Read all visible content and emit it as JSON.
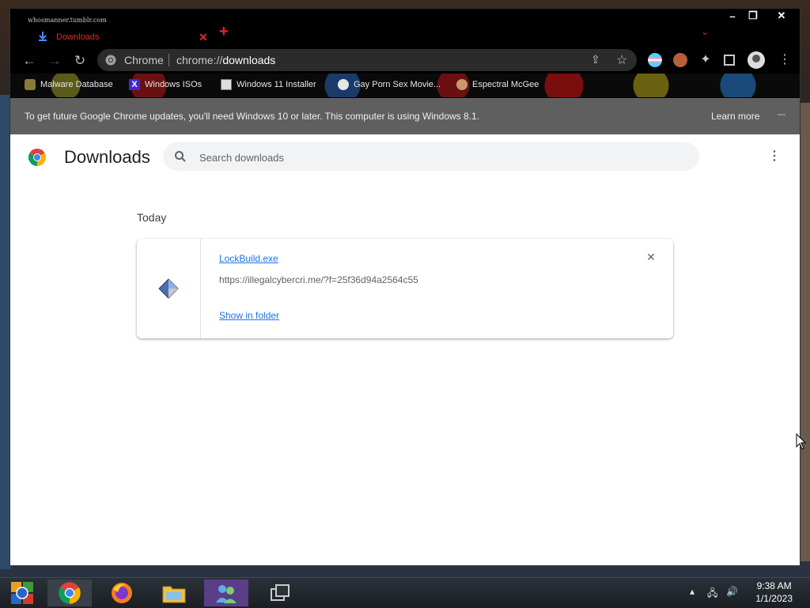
{
  "tab": {
    "site_text": "whosmanner.tumblr.com",
    "title": "Downloads"
  },
  "omnibox": {
    "origin": "Chrome",
    "url_scheme": "chrome://",
    "url_path": "downloads"
  },
  "bookmarks": [
    {
      "label": "Malware Database",
      "icon": "malware-db-icon"
    },
    {
      "label": "Windows ISOs",
      "icon": "x-icon"
    },
    {
      "label": "Windows 11 Installer",
      "icon": "installer-icon"
    },
    {
      "label": "Gay Porn Sex Movie...",
      "icon": "globe-icon"
    },
    {
      "label": "Espectral McGee",
      "icon": "avatar-icon"
    }
  ],
  "infobar": {
    "message": "To get future Google Chrome updates, you'll need Windows 10 or later. This computer is using Windows 8.1.",
    "learn_more": "Learn more"
  },
  "page": {
    "title": "Downloads",
    "search_placeholder": "Search downloads"
  },
  "downloads": {
    "date_group": "Today",
    "items": [
      {
        "filename": "LockBuild.exe",
        "url": "https://illegalcybercri.me/?f=25f36d94a2564c55",
        "action": "Show in folder"
      }
    ]
  },
  "taskbar": {
    "apps": [
      "start-icon",
      "chrome-icon",
      "firefox-icon",
      "file-explorer-icon",
      "messenger-icon",
      "task-view-icon"
    ],
    "time": "9:38 AM",
    "date": "1/1/2023"
  },
  "colors": {
    "link": "#1a73e8",
    "tab_accent": "#e02828",
    "infobar_bg": "#5f5f5f"
  }
}
